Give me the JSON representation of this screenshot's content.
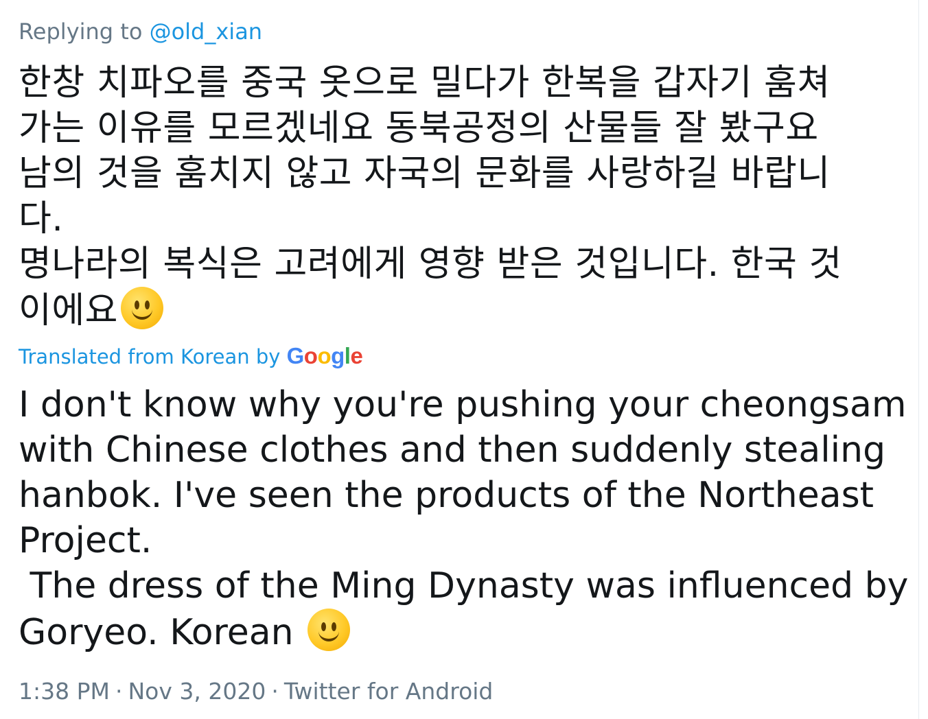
{
  "reply": {
    "prefix": "Replying to ",
    "handle": "@old_xian"
  },
  "original_text": {
    "lines": [
      "한창 치파오를 중국 옷으로 밀다가 한복을 갑자기 훔쳐",
      "가는 이유를 모르겠네요 동북공정의 산물들 잘 봤구요",
      "남의 것을 훔치지 않고 자국의 문화를 사랑하길 바랍니",
      "다.",
      "명나라의 복식은 고려에게 영향 받은 것입니다. 한국 것",
      "이에요"
    ],
    "emoji_icon": "slightly-smiling-face-icon"
  },
  "translation": {
    "label": "Translated from Korean by",
    "provider_letters": [
      "G",
      "o",
      "o",
      "g",
      "l",
      "e"
    ],
    "provider_colors": [
      "#4285f4",
      "#ea4335",
      "#fbbc05",
      "#4285f4",
      "#34a853",
      "#ea4335"
    ],
    "lines": [
      "I don't know why you're pushing your cheongsam",
      "with Chinese clothes and then suddenly stealing",
      "hanbok. I've seen the products of the Northeast",
      "Project.",
      " The dress of the Ming Dynasty was influenced by",
      "Goryeo. Korean "
    ],
    "emoji_icon": "slightly-smiling-face-icon"
  },
  "meta": {
    "time": "1:38 PM",
    "separator": "·",
    "date": "Nov 3, 2020",
    "source": "Twitter for Android"
  },
  "colors": {
    "link": "#1b95e0",
    "text": "#14171a",
    "muted": "#657786"
  }
}
